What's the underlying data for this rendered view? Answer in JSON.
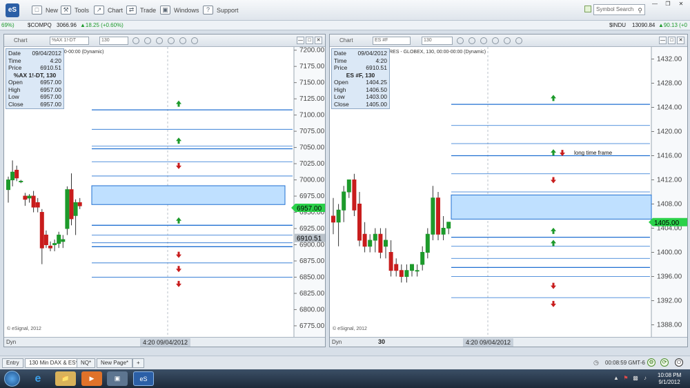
{
  "toolbar": {
    "logo": "eS",
    "items": [
      {
        "label": "New",
        "icon": "new-icon",
        "glyph": "□"
      },
      {
        "label": "Tools",
        "icon": "tools-icon",
        "glyph": "⚒"
      },
      {
        "label": "Chart",
        "icon": "chart-icon",
        "glyph": "↗"
      },
      {
        "label": "Trade",
        "icon": "trade-icon",
        "glyph": "⇄"
      },
      {
        "label": "Windows",
        "icon": "windows-icon",
        "glyph": "▣"
      },
      {
        "label": "Support",
        "icon": "support-icon",
        "glyph": "?"
      }
    ],
    "search_placeholder": "Symbol Search"
  },
  "ticker": {
    "left_change": "69%)",
    "comp_symbol": "$COMPQ",
    "comp_value": "3066.96",
    "comp_change": "▲18.25 (+0.60%)",
    "indu_symbol": "$INDU",
    "indu_value": "13090.84",
    "indu_change": "▲90.13 (+0"
  },
  "colors": {
    "up": "#1d9a2b",
    "down": "#c81d1d",
    "line": "#1f6fd1",
    "zone_fill": "#bfe0ff",
    "zone_border": "#1f6fd1",
    "price_badge": "#2bd14a"
  },
  "left_panel": {
    "title": "Chart",
    "symbol_field": "%AX 1!-DT",
    "interval_field": "130",
    "dyn_label": "00-00:00 (Dynamic)",
    "info": {
      "date_label": "Date",
      "date": "09/04/2012",
      "time_label": "Time",
      "time": "4:20",
      "price_label": "Price",
      "price": "6910.51",
      "symbol": "%AX 1!-DT, 130",
      "open_label": "Open",
      "open": "6957.00",
      "high_label": "High",
      "high": "6957.00",
      "low_label": "Low",
      "low": "6957.00",
      "close_label": "Close",
      "close": "6957.00"
    },
    "price_badge": "6957.00",
    "cursor_badge": "6910.51",
    "copyright": "© eSignal, 2012",
    "footer_dyn": "Dyn",
    "footer_time": "4:20 09/04/2012"
  },
  "right_panel": {
    "title": "Chart",
    "symbol_field": "ES #F",
    "interval_field": "130",
    "dyn_label": "RES - GLOBEX, 130, 00:00-00:00 (Dynamic)",
    "info": {
      "date_label": "Date",
      "date": "09/04/2012",
      "time_label": "Time",
      "time": "4:20",
      "price_label": "Price",
      "price": "6910.51",
      "symbol": "ES #F, 130",
      "open_label": "Open",
      "open": "1404.25",
      "high_label": "High",
      "high": "1406.50",
      "low_label": "Low",
      "low": "1403.00",
      "close_label": "Close",
      "close": "1405.00"
    },
    "price_badge": "1405.00",
    "annotation": "long time frame",
    "copyright": "© eSignal, 2012",
    "footer_dyn": "Dyn",
    "footer_number": "30",
    "footer_time": "4:20 09/04/2012"
  },
  "chart_data": [
    {
      "type": "candlestick",
      "symbol": "%AX 1!-DT, 130",
      "ylim": [
        6760,
        7205
      ],
      "yticks": [
        6775,
        6800,
        6825,
        6850,
        6875,
        6900,
        6925,
        6950,
        6975,
        7000,
        7025,
        7050,
        7075,
        7100,
        7125,
        7150,
        7175,
        7200
      ],
      "candles": [
        {
          "o": 6985,
          "h": 7005,
          "l": 6965,
          "c": 7000
        },
        {
          "o": 7000,
          "h": 7030,
          "l": 6990,
          "c": 7012
        },
        {
          "o": 7015,
          "h": 7022,
          "l": 6998,
          "c": 7003
        },
        {
          "o": 6998,
          "h": 7000,
          "l": 6995,
          "c": 6998
        },
        {
          "o": 6975,
          "h": 6980,
          "l": 6960,
          "c": 6970
        },
        {
          "o": 6972,
          "h": 6978,
          "l": 6965,
          "c": 6975
        },
        {
          "o": 6975,
          "h": 6983,
          "l": 6950,
          "c": 6958
        },
        {
          "o": 6965,
          "h": 6972,
          "l": 6950,
          "c": 6958
        },
        {
          "o": 6950,
          "h": 6955,
          "l": 6870,
          "c": 6895
        },
        {
          "o": 6915,
          "h": 6922,
          "l": 6895,
          "c": 6900
        },
        {
          "o": 6898,
          "h": 6905,
          "l": 6890,
          "c": 6895
        },
        {
          "o": 6900,
          "h": 6908,
          "l": 6890,
          "c": 6902
        },
        {
          "o": 6902,
          "h": 6920,
          "l": 6895,
          "c": 6915
        },
        {
          "o": 6905,
          "h": 6915,
          "l": 6895,
          "c": 6908
        },
        {
          "o": 6925,
          "h": 6990,
          "l": 6915,
          "c": 6985
        },
        {
          "o": 6985,
          "h": 7010,
          "l": 6930,
          "c": 6940
        },
        {
          "o": 6945,
          "h": 6970,
          "l": 6915,
          "c": 6965
        },
        {
          "o": 6965,
          "h": 6972,
          "l": 6955,
          "c": 6960
        }
      ],
      "levels": [
        7108,
        7078,
        7052,
        7048,
        7028,
        7006,
        6930,
        6915,
        6903,
        6897,
        6872,
        6850
      ],
      "zone": [
        6962,
        6991
      ],
      "arrows": [
        {
          "dir": "up",
          "y": 7117
        },
        {
          "dir": "up",
          "y": 7060
        },
        {
          "dir": "down",
          "y": 7022
        },
        {
          "dir": "up",
          "y": 6937
        },
        {
          "dir": "down",
          "y": 6885
        },
        {
          "dir": "down",
          "y": 6863
        },
        {
          "dir": "down",
          "y": 6840
        }
      ]
    },
    {
      "type": "candlestick",
      "symbol": "ES #F, 130",
      "ylim": [
        1386,
        1434
      ],
      "yticks": [
        1388,
        1392,
        1396,
        1400,
        1404,
        1408,
        1412,
        1416,
        1420,
        1424,
        1428,
        1432
      ],
      "candles": [
        {
          "o": 1406,
          "h": 1409,
          "l": 1403,
          "c": 1405
        },
        {
          "o": 1405,
          "h": 1408,
          "l": 1401,
          "c": 1407
        },
        {
          "o": 1407,
          "h": 1411,
          "l": 1405,
          "c": 1410
        },
        {
          "o": 1410,
          "h": 1412,
          "l": 1409,
          "c": 1412
        },
        {
          "o": 1412,
          "h": 1413,
          "l": 1406,
          "c": 1407
        },
        {
          "o": 1408,
          "h": 1410,
          "l": 1401,
          "c": 1402
        },
        {
          "o": 1403,
          "h": 1405,
          "l": 1400,
          "c": 1401
        },
        {
          "o": 1401,
          "h": 1403,
          "l": 1400,
          "c": 1402
        },
        {
          "o": 1402,
          "h": 1404,
          "l": 1400,
          "c": 1403
        },
        {
          "o": 1403,
          "h": 1404,
          "l": 1399,
          "c": 1400
        },
        {
          "o": 1401,
          "h": 1404,
          "l": 1399,
          "c": 1402
        },
        {
          "o": 1400,
          "h": 1402,
          "l": 1396,
          "c": 1397
        },
        {
          "o": 1398,
          "h": 1399,
          "l": 1396,
          "c": 1397
        },
        {
          "o": 1397,
          "h": 1398,
          "l": 1395,
          "c": 1396
        },
        {
          "o": 1396,
          "h": 1398,
          "l": 1395,
          "c": 1397
        },
        {
          "o": 1397,
          "h": 1398,
          "l": 1396,
          "c": 1398
        },
        {
          "o": 1397,
          "h": 1398,
          "l": 1396,
          "c": 1397
        },
        {
          "o": 1398,
          "h": 1401,
          "l": 1397,
          "c": 1400
        },
        {
          "o": 1400,
          "h": 1404,
          "l": 1399,
          "c": 1403
        },
        {
          "o": 1403,
          "h": 1411,
          "l": 1402,
          "c": 1409
        },
        {
          "o": 1409,
          "h": 1410,
          "l": 1402,
          "c": 1403
        },
        {
          "o": 1403,
          "h": 1406,
          "l": 1402,
          "c": 1404
        },
        {
          "o": 1404,
          "h": 1405,
          "l": 1403,
          "c": 1405
        }
      ],
      "levels": [
        1424.5,
        1421,
        1418,
        1416,
        1413,
        1410,
        1402.5,
        1401,
        1399,
        1397.5,
        1396,
        1392.5
      ],
      "zone": [
        1405.5,
        1409.5
      ],
      "arrows": [
        {
          "dir": "up",
          "y": 1425.5
        },
        {
          "dir": "up",
          "y": 1416.5
        },
        {
          "dir": "down",
          "y": 1416.5
        },
        {
          "dir": "down",
          "y": 1412
        },
        {
          "dir": "up",
          "y": 1403.5
        },
        {
          "dir": "up",
          "y": 1401.5
        },
        {
          "dir": "down",
          "y": 1394.5
        },
        {
          "dir": "down",
          "y": 1391.5
        }
      ]
    }
  ],
  "tabs": [
    {
      "label": "Entry",
      "active": false
    },
    {
      "label": "130 Min DAX & ES*",
      "active": true
    },
    {
      "label": "NQ*",
      "active": false
    },
    {
      "label": "New Page*",
      "active": false
    },
    {
      "label": "+",
      "active": false
    }
  ],
  "status": {
    "gmt_clock": "00:08:59 GMT-6"
  },
  "taskbar": {
    "time": "10:08 PM",
    "date": "9/1/2012",
    "app_label": "eS"
  }
}
